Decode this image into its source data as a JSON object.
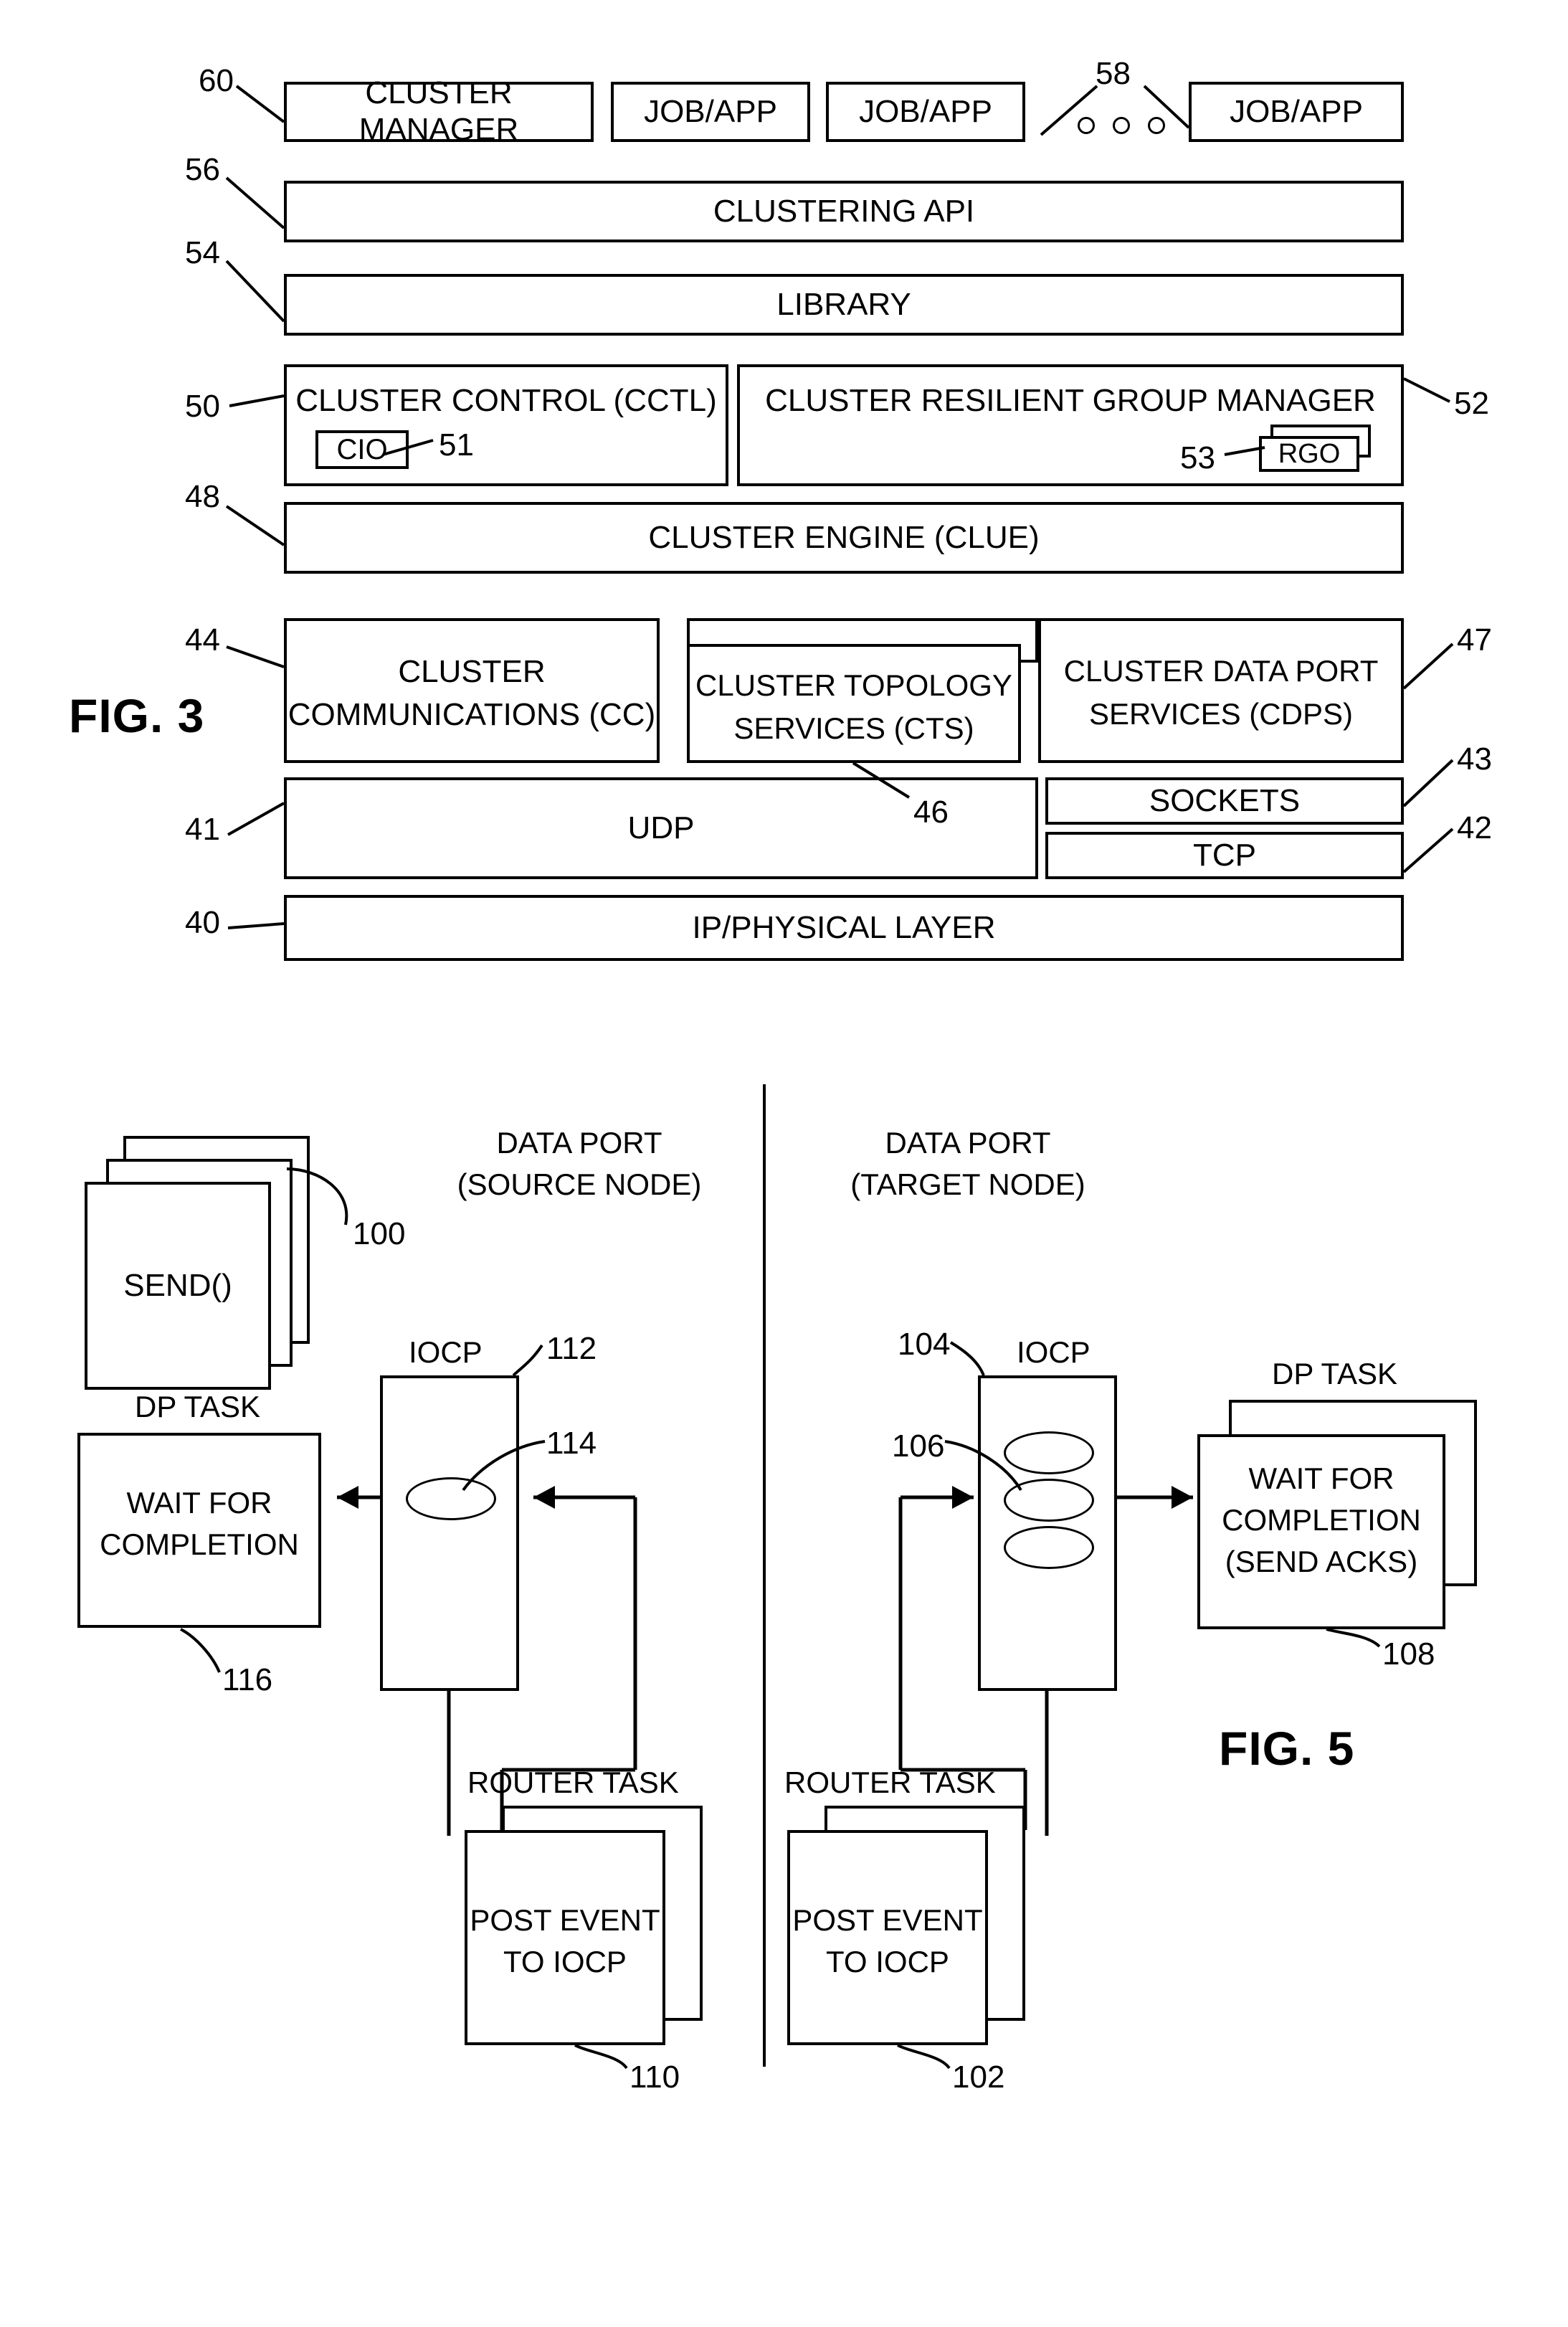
{
  "figures": [
    {
      "id": "fig3",
      "label": "FIG. 3",
      "boxes": {
        "cluster_manager": "CLUSTER MANAGER",
        "job_app_1": "JOB/APP",
        "job_app_2": "JOB/APP",
        "job_app_3": "JOB/APP",
        "clustering_api": "CLUSTERING API",
        "library": "LIBRARY",
        "cluster_control": "CLUSTER CONTROL (CCTL)",
        "cio": "CIO",
        "cluster_resilient_group_manager": "CLUSTER RESILIENT GROUP MANAGER",
        "rgo": "RGO",
        "cluster_engine": "CLUSTER ENGINE (CLUE)",
        "cluster_communications_l1": "CLUSTER",
        "cluster_communications_l2": "COMMUNICATIONS (CC)",
        "cluster_topology_l1": "CLUSTER TOPOLOGY",
        "cluster_topology_l2": "SERVICES (CTS)",
        "cluster_data_port_l1": "CLUSTER DATA PORT",
        "cluster_data_port_l2": "SERVICES (CDPS)",
        "udp": "UDP",
        "sockets": "SOCKETS",
        "tcp": "TCP",
        "ip_physical_layer": "IP/PHYSICAL LAYER"
      },
      "refs": {
        "r60": "60",
        "r58": "58",
        "r56": "56",
        "r54": "54",
        "r50": "50",
        "r51": "51",
        "r52": "52",
        "r53": "53",
        "r48": "48",
        "r44": "44",
        "r46": "46",
        "r47": "47",
        "r43": "43",
        "r42": "42",
        "r41": "41",
        "r40": "40"
      },
      "ellipsis": "o o o"
    },
    {
      "id": "fig5",
      "label": "FIG. 5",
      "headings": {
        "source_line1": "DATA PORT",
        "source_line2": "(SOURCE NODE)",
        "target_line1": "DATA PORT",
        "target_line2": "(TARGET NODE)",
        "dp_task_left": "DP TASK",
        "dp_task_right": "DP TASK",
        "iocp_left": "IOCP",
        "iocp_right": "IOCP",
        "router_task_left": "ROUTER TASK",
        "router_task_right": "ROUTER TASK"
      },
      "boxes": {
        "send": "SEND()",
        "wait_left_l1": "WAIT FOR",
        "wait_left_l2": "COMPLETION",
        "wait_right_l1": "WAIT FOR",
        "wait_right_l2": "COMPLETION",
        "wait_right_l3": "(SEND ACKS)",
        "post_event_left_l1": "POST EVENT",
        "post_event_left_l2": "TO IOCP",
        "post_event_right_l1": "POST EVENT",
        "post_event_right_l2": "TO IOCP"
      },
      "refs": {
        "r100": "100",
        "r112": "112",
        "r114": "114",
        "r116": "116",
        "r110": "110",
        "r104": "104",
        "r106": "106",
        "r108": "108",
        "r102": "102"
      }
    }
  ],
  "colors": {
    "ink": "#000000",
    "paper": "#ffffff"
  }
}
